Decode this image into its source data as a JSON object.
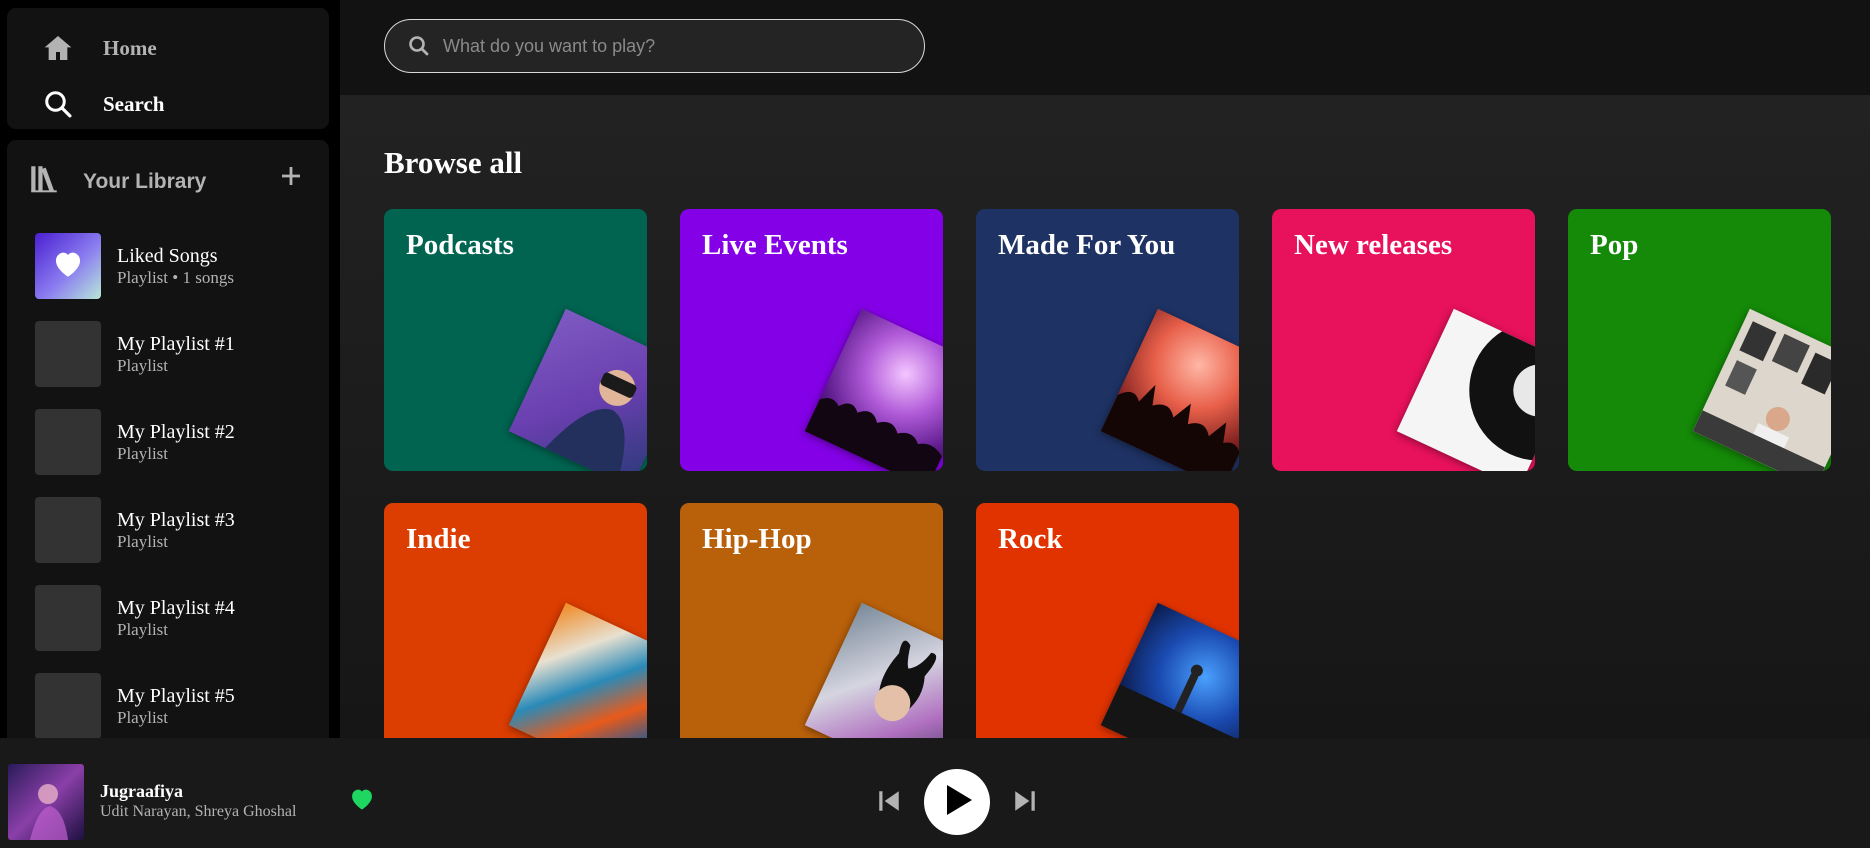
{
  "nav": {
    "home_label": "Home",
    "search_label": "Search"
  },
  "library": {
    "title": "Your Library",
    "items": [
      {
        "name": "Liked Songs",
        "subtitle": "Playlist • 1 songs"
      },
      {
        "name": "My Playlist #1",
        "subtitle": "Playlist"
      },
      {
        "name": "My Playlist #2",
        "subtitle": "Playlist"
      },
      {
        "name": "My Playlist #3",
        "subtitle": "Playlist"
      },
      {
        "name": "My Playlist #4",
        "subtitle": "Playlist"
      },
      {
        "name": "My Playlist #5",
        "subtitle": "Playlist"
      }
    ]
  },
  "search": {
    "placeholder": "What do you want to play?"
  },
  "browse": {
    "title": "Browse all",
    "categories": [
      {
        "label": "Podcasts",
        "color": "#006450"
      },
      {
        "label": "Live Events",
        "color": "#8400e7"
      },
      {
        "label": "Made For You",
        "color": "#1e3264"
      },
      {
        "label": "New releases",
        "color": "#e8115b"
      },
      {
        "label": "Pop",
        "color": "#148a08"
      },
      {
        "label": "Indie",
        "color": "#e13300"
      },
      {
        "label": "Hip-Hop",
        "color": "#ba5d07"
      },
      {
        "label": "Rock",
        "color": "#e13300"
      }
    ]
  },
  "player": {
    "track_title": "Jugraafiya",
    "track_artist": "Udit Narayan, Shreya Ghoshal",
    "liked": true,
    "accent_color": "#1ed760"
  }
}
